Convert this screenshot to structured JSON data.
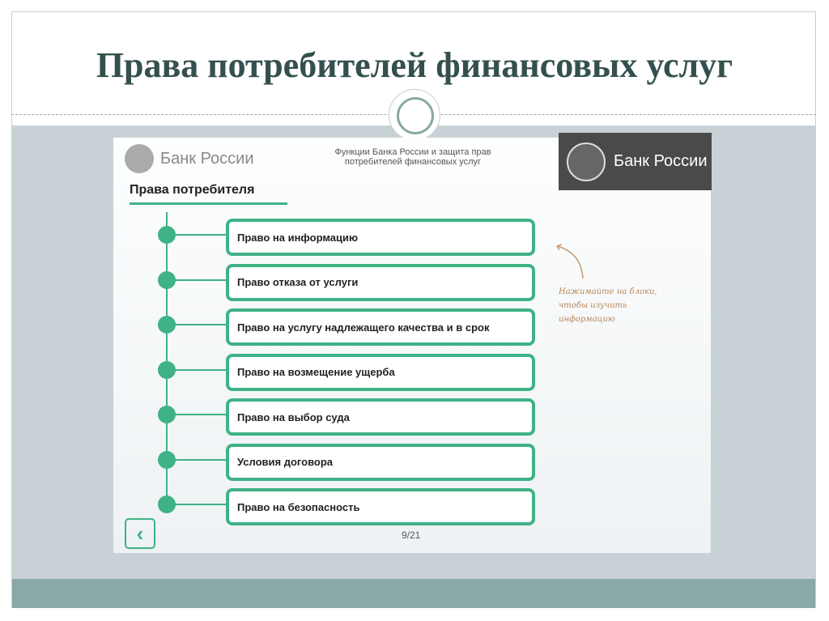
{
  "title": "Права потребителей финансовых услуг",
  "slide": {
    "logo_text": "Банк России",
    "subtitle": "Функции Банка России и защита прав потребителей финансовых услуг",
    "brand_text": "Банк России",
    "heading": "Права потребителя",
    "items": [
      "Право на информацию",
      "Право отказа от услуги",
      "Право на услугу надлежащего качества и в срок",
      "Право на возмещение ущерба",
      "Право на выбор суда",
      "Условия договора",
      "Право на безопасность"
    ],
    "hint": "Нажимайте на блоки, чтобы изучить информацию",
    "back": "‹",
    "page": "9/21"
  }
}
